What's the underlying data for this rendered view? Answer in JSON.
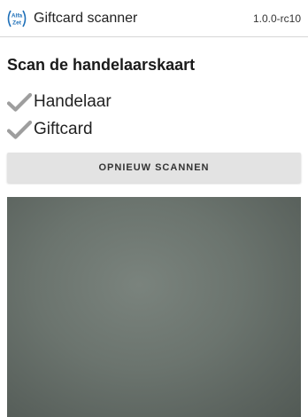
{
  "app_bar": {
    "logo_text_top": "Alfa",
    "logo_text_bottom": "Zet",
    "title": "Giftcard scanner",
    "version": "1.0.0-rc10"
  },
  "main": {
    "heading": "Scan de handelaarskaart",
    "checklist": [
      {
        "label": "Handelaar",
        "icon": "check-icon"
      },
      {
        "label": "Giftcard",
        "icon": "check-icon"
      }
    ],
    "rescan_label": "OPNIEUW SCANNEN"
  },
  "colors": {
    "check": "#9e9e9e",
    "button_bg": "#e3e3e3",
    "camera_bg": "#6b746e",
    "logo_blue": "#1e6fb8"
  }
}
